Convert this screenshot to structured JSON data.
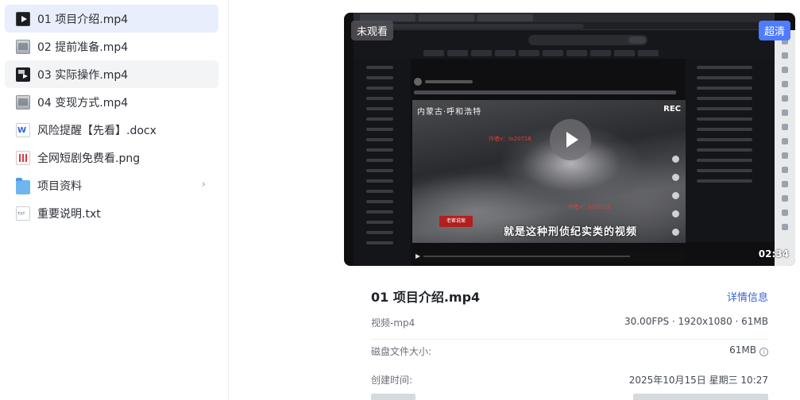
{
  "files": [
    {
      "name": "01 项目介绍.mp4",
      "icon": "video-file-icon",
      "state": "selected"
    },
    {
      "name": "02 提前准备.mp4",
      "icon": "video-file-icon",
      "state": ""
    },
    {
      "name": "03 实际操作.mp4",
      "icon": "video-file-icon",
      "state": "hover"
    },
    {
      "name": "04 变现方式.mp4",
      "icon": "video-file-icon",
      "state": ""
    },
    {
      "name": "风险提醒【先看】.docx",
      "icon": "word-doc-icon",
      "state": ""
    },
    {
      "name": "全网短剧免费看.png",
      "icon": "image-file-icon",
      "state": ""
    },
    {
      "name": "项目资料",
      "icon": "folder-icon",
      "state": "",
      "chevron": "›"
    },
    {
      "name": "重要说明.txt",
      "icon": "text-file-icon",
      "state": ""
    }
  ],
  "preview": {
    "badge_unwatched": "未观看",
    "badge_quality": "超清",
    "duration": "02:34",
    "frame": {
      "caption_top": "内蒙古·呼和浩特",
      "rec": "REC",
      "red_text_1": "作者v：lo20718",
      "red_text_2": "作者v：lo20718",
      "stamp": "老崔说案",
      "subtitle": "就是这种刑侦纪实类的视频"
    }
  },
  "info": {
    "title": "01 项目介绍.mp4",
    "detail_link": "详情信息",
    "type": "视频-mp4",
    "specs": "30.00FPS · 1920x1080 · 61MB",
    "disk_size_label": "磁盘文件大小:",
    "disk_size_value": "61MB",
    "info_glyph": "i",
    "created_label": "创建时间:",
    "created_value": "2025年10月15日 星期三 10:27"
  },
  "colors": {
    "selected_bg": "#e8eefb",
    "link": "#3a63d6",
    "quality_badge": "#4f7bff"
  }
}
